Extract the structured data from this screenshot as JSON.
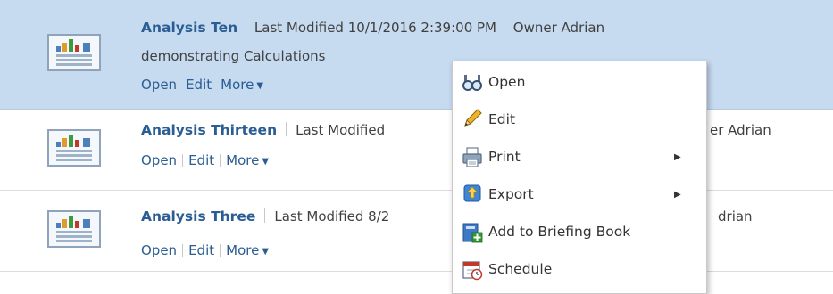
{
  "rows": [
    {
      "title": "Analysis Ten",
      "modified_label": "Last Modified",
      "modified_value": "10/1/2016 2:39:00 PM",
      "owner_label": "Owner",
      "owner_value": "Adrian",
      "description": "demonstrating Calculations",
      "actions": {
        "open": "Open",
        "edit": "Edit",
        "more": "More"
      }
    },
    {
      "title": "Analysis Thirteen",
      "modified_label": "Last Modified",
      "owner_partial": "er Adrian",
      "actions": {
        "open": "Open",
        "edit": "Edit",
        "more": "More"
      }
    },
    {
      "title": "Analysis Three",
      "modified_label": "Last Modified",
      "modified_partial": "8/2",
      "owner_partial": "drian",
      "actions": {
        "open": "Open",
        "edit": "Edit",
        "more": "More"
      }
    }
  ],
  "menu": {
    "items": [
      {
        "label": "Open",
        "icon": "glasses-icon",
        "submenu": false
      },
      {
        "label": "Edit",
        "icon": "pencil-icon",
        "submenu": false
      },
      {
        "label": "Print",
        "icon": "printer-icon",
        "submenu": true
      },
      {
        "label": "Export",
        "icon": "export-icon",
        "submenu": true
      },
      {
        "label": "Add to Briefing Book",
        "icon": "briefing-book-add-icon",
        "submenu": false
      },
      {
        "label": "Schedule",
        "icon": "calendar-clock-icon",
        "submenu": false
      }
    ]
  },
  "colors": {
    "selected_row_bg": "#c6daf0",
    "title_link": "#2a5d93",
    "menu_border": "#c9c9c9"
  }
}
